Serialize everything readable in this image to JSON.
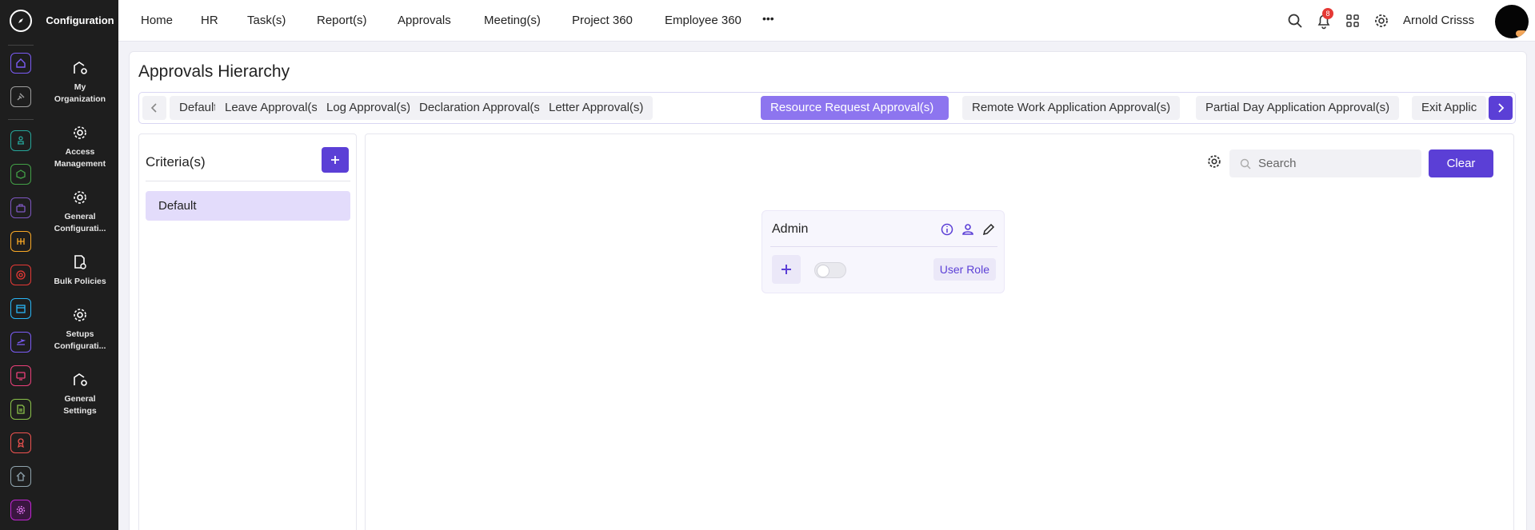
{
  "app": {
    "section_title": "Configuration"
  },
  "rail": {
    "items": [
      {
        "icon": "home-icon",
        "color": "#7b5cf5"
      },
      {
        "icon": "pin-icon",
        "color": "#9e9e9e"
      },
      {
        "icon": "org-chart-icon",
        "color": "#26a69a"
      },
      {
        "icon": "box-icon",
        "color": "#43a047"
      },
      {
        "icon": "briefcase-icon",
        "color": "#7e57c2"
      },
      {
        "icon": "hand-money-icon",
        "color": "#f9a825"
      },
      {
        "icon": "target-icon",
        "color": "#e53935"
      },
      {
        "icon": "archive-icon",
        "color": "#29b6f6"
      },
      {
        "icon": "plane-icon",
        "color": "#7b5cf5"
      },
      {
        "icon": "monitor-icon",
        "color": "#ec407a"
      },
      {
        "icon": "document-icon",
        "color": "#8bc34a"
      },
      {
        "icon": "award-icon",
        "color": "#ef5350"
      },
      {
        "icon": "house-icon",
        "color": "#90a4ae"
      },
      {
        "icon": "settings-icon",
        "color": "#c026d3"
      }
    ]
  },
  "config_menu": {
    "items": [
      {
        "label_1": "My",
        "label_2": "Organization"
      },
      {
        "label_1": "Access",
        "label_2": "Management"
      },
      {
        "label_1": "General",
        "label_2": "Configurati..."
      },
      {
        "label_1": "Bulk Policies",
        "label_2": ""
      },
      {
        "label_1": "Setups",
        "label_2": "Configurati..."
      },
      {
        "label_1": "General",
        "label_2": "Settings"
      }
    ]
  },
  "topnav": {
    "items": [
      "Home",
      "HR",
      "Task(s)",
      "Report(s)",
      "Approvals",
      "Meeting(s)",
      "Project 360",
      "Employee 360"
    ],
    "more": "•••",
    "notification_count": "8",
    "user_name": "Arnold Crisss"
  },
  "page": {
    "title": "Approvals Hierarchy",
    "tabs": [
      "Default",
      "Leave Approval(s)",
      "Log Approval(s)",
      "Declaration Approval(s)",
      "Letter Approval(s)",
      "Resource Request Approval(s)",
      "Remote Work Application Approval(s)",
      "Partial Day Application Approval(s)",
      "Exit Applic"
    ],
    "active_tab": "Resource Request Approval(s)"
  },
  "criteria": {
    "title": "Criteria(s)",
    "items": [
      "Default"
    ]
  },
  "toolbar": {
    "search_placeholder": "Search",
    "clear_label": "Clear"
  },
  "node": {
    "title": "Admin",
    "role_label": "User Role",
    "toggle_on": false
  },
  "colors": {
    "accent": "#5b3fd6",
    "active_tab": "#8d75ef",
    "sidebar_bg": "#1e1e1e"
  }
}
